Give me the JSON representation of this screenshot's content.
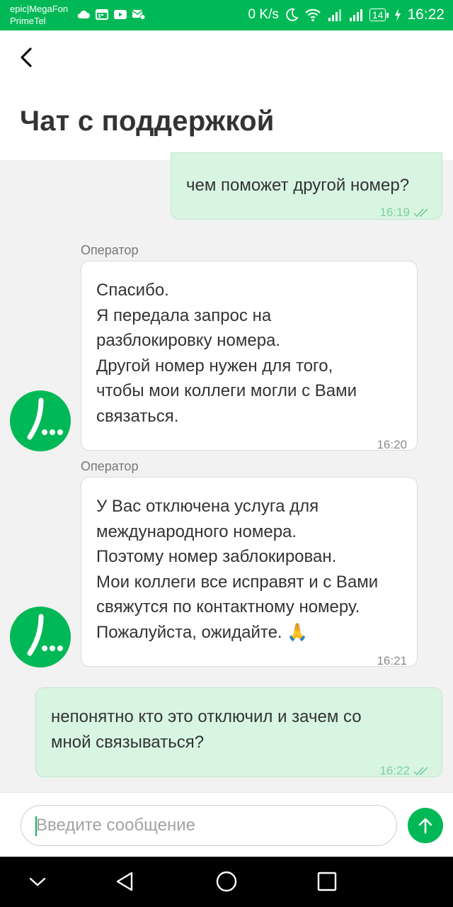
{
  "status_bar": {
    "carrier_line1": "epic|MegaFon",
    "carrier_line2": "PrimeTel",
    "speed": "0 K/s",
    "battery": "14",
    "time": "16:22"
  },
  "header": {
    "title": "Чат с поддержкой"
  },
  "messages": [
    {
      "direction": "out",
      "text": "чем поможет другой номер?",
      "time": "16:19"
    },
    {
      "direction": "in",
      "sender": "Оператор",
      "text": "Спасибо.\nЯ передала запрос на\nразблокировку номера.\nДругой номер нужен для того,\nчтобы мои коллеги могли с Вами\nсвязаться.",
      "time": "16:20"
    },
    {
      "direction": "in",
      "sender": "Оператор",
      "text": "У Вас отключена услуга для\nмеждународного номера.\nПоэтому номер заблокирован.\nМои коллеги все исправят и с Вами\nсвяжутся по контактному номеру.\nПожалуйста, ожидайте. 🙏",
      "time": "16:21"
    },
    {
      "direction": "out",
      "text": "непонятно кто это отключил и зачем со\nмной связываться?",
      "time": "16:22"
    }
  ],
  "composer": {
    "placeholder": "Введите сообщение",
    "value": ""
  },
  "colors": {
    "brand": "#00b956",
    "outgoing_bubble": "#d8f5e2",
    "incoming_bubble": "#ffffff"
  },
  "icons": {
    "back": "arrow-left-icon",
    "send": "arrow-up-icon",
    "avatar": "megafon-logo-icon",
    "read": "double-check-icon",
    "nav_back": "triangle-back-icon",
    "nav_home": "circle-home-icon",
    "nav_recent": "square-recent-icon",
    "nav_hide": "chevron-down-icon"
  }
}
